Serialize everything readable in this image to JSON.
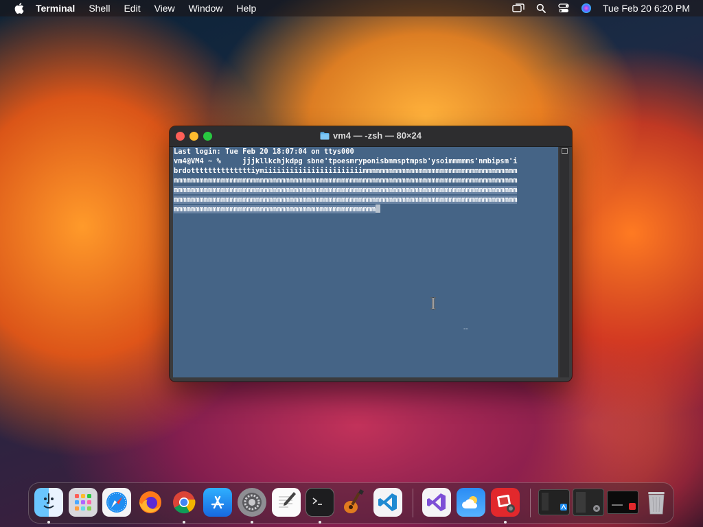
{
  "menubar": {
    "app_name": "Terminal",
    "menus": [
      "Shell",
      "Edit",
      "View",
      "Window",
      "Help"
    ],
    "clock": "Tue Feb 20  6:20 PM"
  },
  "terminal": {
    "title": "vm4 — -zsh — 80×24",
    "lines": [
      "Last login: Tue Feb 20 18:07:04 on ttys000",
      "vm4@VM4 ~ %     jjjkllkchjkdpg sbne'tpoesmryponisbmmsptmpsb'ysoimmmmms'nmbipsm'i",
      "brdottttttttttttttiymiiiiiiiiiiiiiiiiiiiiiiimmmmmmmmmmmmmmmmmmmmmmmmmmmmmmmmmmmm",
      "mmmmmmmmmmmmmmmmmmmmmmmmmmmmmmmmmmmmmmmmmmmmmmmmmmmmmmmmmmmmmmmmmmmmmmmmmmmmmmmm",
      "mmmmmmmmmmmmmmmmmmmmmmmmmmmmmmmmmmmmmmmmmmmmmmmmmmmmmmmmmmmmmmmmmmmmmmmmmmmmmmmm",
      "mmmmmmmmmmmmmmmmmmmmmmmmmmmmmmmmmmmmmmmmmmmmmmmmmmmmmmmmmmmmmmmmmmmmmmmmmmmmmmmm",
      "mmmmmmmmmmmmmmmmmmmmmmmmmmmmmmmmmmmmmmmmmmmmmmm"
    ],
    "overlay_mark": "--",
    "background_color": "#456486"
  },
  "dock": {
    "items": [
      {
        "name": "Finder",
        "icon": "finder-icon",
        "running": true
      },
      {
        "name": "Launchpad",
        "icon": "launchpad-icon",
        "running": false
      },
      {
        "name": "Safari",
        "icon": "safari-icon",
        "running": false
      },
      {
        "name": "Firefox",
        "icon": "firefox-icon",
        "running": false
      },
      {
        "name": "Google Chrome",
        "icon": "chrome-icon",
        "running": true
      },
      {
        "name": "App Store",
        "icon": "app-store-icon",
        "running": false
      },
      {
        "name": "System Settings",
        "icon": "system-settings-icon",
        "running": true
      },
      {
        "name": "TextEdit",
        "icon": "textedit-icon",
        "running": false
      },
      {
        "name": "Terminal",
        "icon": "terminal-icon",
        "running": true
      },
      {
        "name": "GarageBand",
        "icon": "garageband-icon",
        "running": false
      },
      {
        "name": "Visual Studio Code",
        "icon": "vscode-icon",
        "running": false
      },
      {
        "name": "Visual Studio",
        "icon": "visual-studio-icon",
        "running": false
      },
      {
        "name": "Weather",
        "icon": "weather-icon",
        "running": false
      },
      {
        "name": "Photo Booth",
        "icon": "photo-booth-icon",
        "running": true
      }
    ]
  }
}
